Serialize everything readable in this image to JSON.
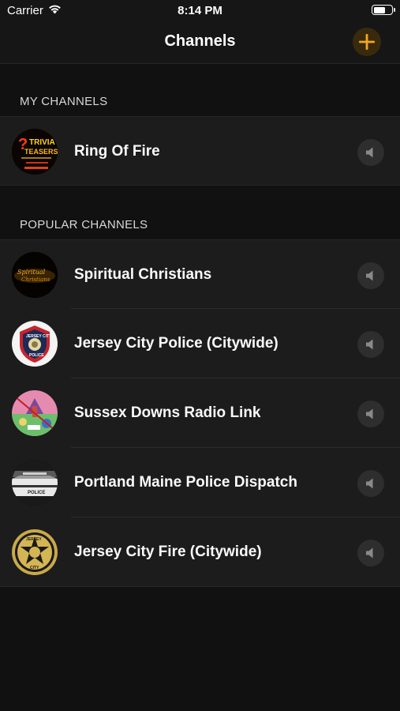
{
  "status_bar": {
    "carrier": "Carrier",
    "time": "8:14 PM",
    "battery_level": 0.7
  },
  "nav": {
    "title": "Channels",
    "add_icon": "plus-icon",
    "accent_color": "#f5a623"
  },
  "my_channels": {
    "header": "MY CHANNELS",
    "items": [
      {
        "label": "Ring Of Fire",
        "avatar_icon": "trivia-teasers-logo"
      }
    ]
  },
  "popular_channels": {
    "header": "POPULAR CHANNELS",
    "items": [
      {
        "label": "Spiritual Christians",
        "avatar_icon": "spiritual-christians-logo"
      },
      {
        "label": "Jersey City Police (Citywide)",
        "avatar_icon": "police-badge-logo"
      },
      {
        "label": "Sussex Downs Radio Link",
        "avatar_icon": "illustrated-scene-avatar"
      },
      {
        "label": "Portland Maine Police Dispatch",
        "avatar_icon": "police-car-photo"
      },
      {
        "label": "Jersey City Fire (Citywide)",
        "avatar_icon": "fire-department-badge"
      }
    ]
  }
}
